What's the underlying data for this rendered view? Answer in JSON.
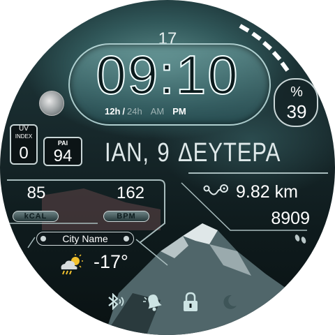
{
  "date": {
    "day_of_month": "17",
    "month_abbr": "ΙΑΝ,",
    "day": "9",
    "weekday": "ΔΕΥΤΕΡΑ"
  },
  "time": {
    "display": "09:10",
    "format_12h": "12h",
    "separator": "/",
    "format_24h": "24h",
    "am": "AM",
    "pm": "PM",
    "active_period": "PM"
  },
  "battery": {
    "symbol": "%",
    "value": "39",
    "arc_level_percent": 39
  },
  "uv": {
    "title": "UV",
    "subtitle": "INDEX",
    "value": "0"
  },
  "pai": {
    "title": "PAI",
    "value": "94"
  },
  "activity": {
    "kcal_value": "85",
    "kcal_label": "kCAL",
    "bpm_value": "162",
    "bpm_label": "BPM",
    "distance": "9.82 km",
    "steps": "8909"
  },
  "weather": {
    "city": "City Name",
    "temperature": "-17°",
    "icon": "partly-cloudy-sun-icon"
  },
  "status_icons": [
    "bluetooth-icon",
    "bell-icon",
    "lock-icon",
    "moon-icon"
  ],
  "colors": {
    "accent": "#ffffff",
    "inactive": "#9fb3b4",
    "status_icon": "#cde4e4"
  }
}
